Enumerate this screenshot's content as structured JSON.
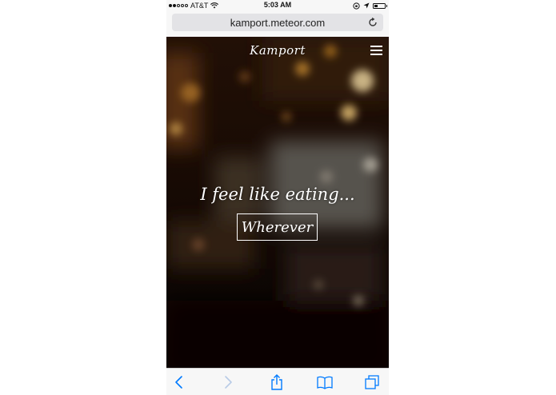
{
  "status_bar": {
    "carrier": "AT&T",
    "time": "5:03 AM",
    "signal_bars_filled": 2,
    "signal_bars_total": 5,
    "battery_level": 0.3
  },
  "browser": {
    "url": "kamport.meteor.com"
  },
  "page": {
    "logo": "Kamport",
    "tagline": "I feel like eating...",
    "choice_button": "Wherever"
  },
  "toolbar": {
    "icons": [
      "back-icon",
      "forward-icon",
      "share-icon",
      "bookmarks-icon",
      "tabs-icon"
    ]
  },
  "colors": {
    "accent": "#007aff",
    "accent_disabled": "#b8cbe6"
  }
}
